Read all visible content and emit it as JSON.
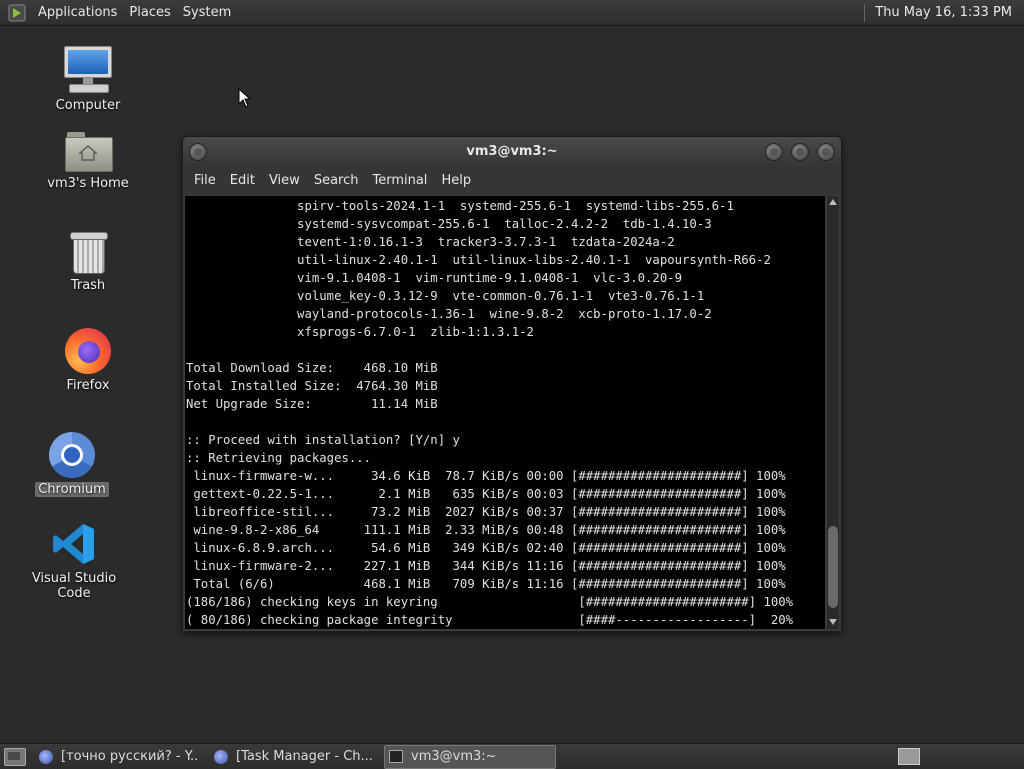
{
  "top_panel": {
    "menus": [
      "Applications",
      "Places",
      "System"
    ],
    "clock": "Thu May 16,  1:33 PM"
  },
  "desktop_icons": {
    "computer": "Computer",
    "home": "vm3's Home",
    "trash": "Trash",
    "firefox": "Firefox",
    "chromium": "Chromium",
    "vscode": "Visual Studio Code"
  },
  "terminal": {
    "title": "vm3@vm3:~",
    "menu": [
      "File",
      "Edit",
      "View",
      "Search",
      "Terminal",
      "Help"
    ],
    "lines": [
      "               spirv-tools-2024.1-1  systemd-255.6-1  systemd-libs-255.6-1",
      "               systemd-sysvcompat-255.6-1  talloc-2.4.2-2  tdb-1.4.10-3",
      "               tevent-1:0.16.1-3  tracker3-3.7.3-1  tzdata-2024a-2",
      "               util-linux-2.40.1-1  util-linux-libs-2.40.1-1  vapoursynth-R66-2",
      "               vim-9.1.0408-1  vim-runtime-9.1.0408-1  vlc-3.0.20-9",
      "               volume_key-0.3.12-9  vte-common-0.76.1-1  vte3-0.76.1-1",
      "               wayland-protocols-1.36-1  wine-9.8-2  xcb-proto-1.17.0-2",
      "               xfsprogs-6.7.0-1  zlib-1:1.3.1-2",
      "",
      "Total Download Size:    468.10 MiB",
      "Total Installed Size:  4764.30 MiB",
      "Net Upgrade Size:        11.14 MiB",
      "",
      ":: Proceed with installation? [Y/n] y",
      ":: Retrieving packages...",
      " linux-firmware-w...     34.6 KiB  78.7 KiB/s 00:00 [######################] 100%",
      " gettext-0.22.5-1...      2.1 MiB   635 KiB/s 00:03 [######################] 100%",
      " libreoffice-stil...     73.2 MiB  2027 KiB/s 00:37 [######################] 100%",
      " wine-9.8-2-x86_64      111.1 MiB  2.33 MiB/s 00:48 [######################] 100%",
      " linux-6.8.9.arch...     54.6 MiB   349 KiB/s 02:40 [######################] 100%",
      " linux-firmware-2...    227.1 MiB   344 KiB/s 11:16 [######################] 100%",
      " Total (6/6)            468.1 MiB   709 KiB/s 11:16 [######################] 100%",
      "(186/186) checking keys in keyring                   [######################] 100%",
      "( 80/186) checking package integrity                 [####------------------]  20%"
    ]
  },
  "taskbar": {
    "tasks": [
      {
        "label": "[точно русский? - Y...",
        "icon": "firefox-icon"
      },
      {
        "label": "[Task Manager - Ch...",
        "icon": "firefox-icon"
      },
      {
        "label": "vm3@vm3:~",
        "icon": "terminal-icon"
      }
    ]
  },
  "colors": {
    "desktop_bg": "#2b2b2b",
    "panel_bg": "#353535",
    "terminal_bg": "#000000",
    "terminal_fg": "#e0e0e0"
  }
}
